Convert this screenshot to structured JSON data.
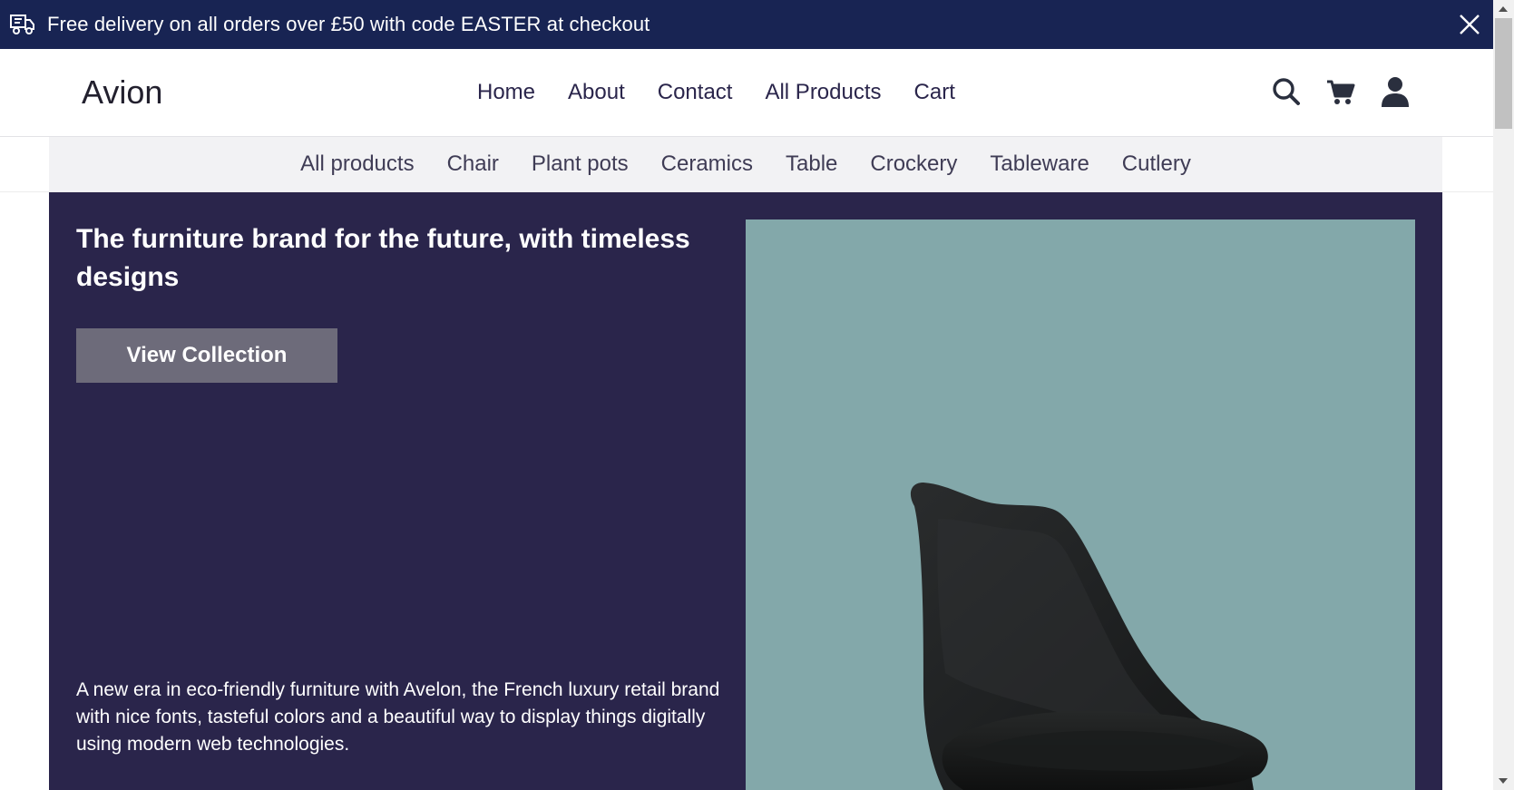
{
  "promo": {
    "icon": "truck-icon",
    "text": "Free delivery on all orders over £50 with code EASTER at checkout",
    "close_icon": "close-icon",
    "background": "#182453"
  },
  "header": {
    "logo": "Avion",
    "nav": [
      "Home",
      "About",
      "Contact",
      "All Products",
      "Cart"
    ],
    "icons": [
      "search-icon",
      "cart-icon",
      "user-icon"
    ]
  },
  "categories": [
    "All products",
    "Chair",
    "Plant pots",
    "Ceramics",
    "Table",
    "Crockery",
    "Tableware",
    "Cutlery"
  ],
  "hero": {
    "title": "The furniture brand for the future, with timeless designs",
    "button": "View Collection",
    "description": "A new era in eco-friendly furniture with Avelon, the French luxury retail brand with nice fonts, tasteful colors and a beautiful way to display things digitally using modern web technologies.",
    "image": "black-chair-image",
    "background": "#2a254b",
    "image_background": "#83a8aa"
  }
}
